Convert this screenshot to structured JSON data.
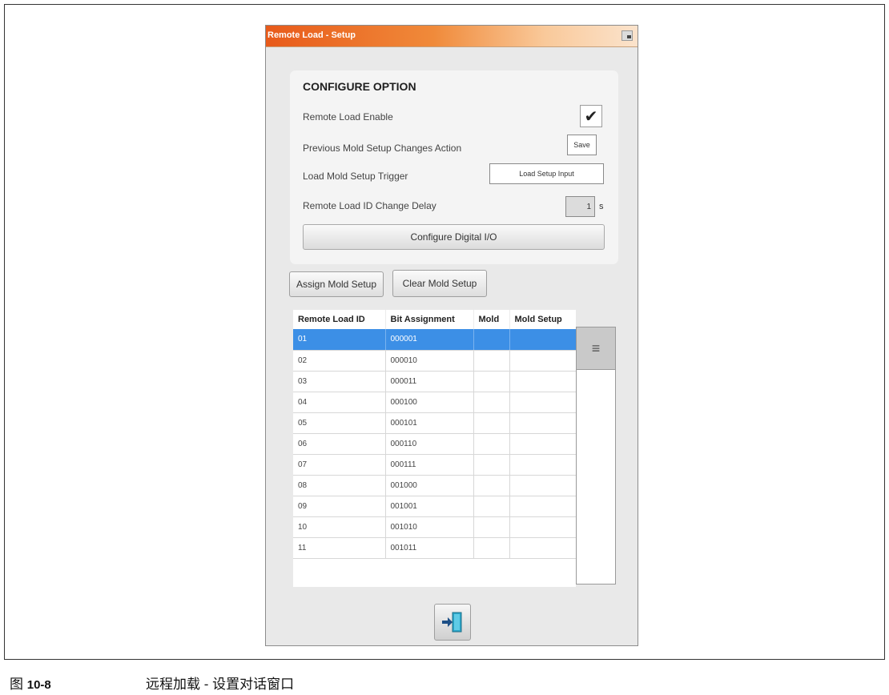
{
  "dialog": {
    "title": "Remote Load - Setup",
    "config": {
      "heading": "CONFIGURE OPTION",
      "remote_load_enable_label": "Remote Load Enable",
      "remote_load_enable_checked": true,
      "check_glyph": "✔",
      "prev_changes_label": "Previous Mold Setup Changes Action",
      "prev_changes_value": "Save",
      "trigger_label": "Load Mold Setup Trigger",
      "trigger_value": "Load Setup Input",
      "delay_label": "Remote Load ID Change Delay",
      "delay_value": "1",
      "delay_unit": "s",
      "configure_io_label": "Configure Digital I/O"
    },
    "assign_button": "Assign Mold Setup",
    "clear_button": "Clear Mold Setup",
    "table": {
      "headers": [
        "Remote Load ID",
        "Bit Assignment",
        "Mold",
        "Mold Setup"
      ],
      "rows": [
        {
          "id": "01",
          "bits": "000001",
          "mold": "",
          "setup": ""
        },
        {
          "id": "02",
          "bits": "000010",
          "mold": "",
          "setup": ""
        },
        {
          "id": "03",
          "bits": "000011",
          "mold": "",
          "setup": ""
        },
        {
          "id": "04",
          "bits": "000100",
          "mold": "",
          "setup": ""
        },
        {
          "id": "05",
          "bits": "000101",
          "mold": "",
          "setup": ""
        },
        {
          "id": "06",
          "bits": "000110",
          "mold": "",
          "setup": ""
        },
        {
          "id": "07",
          "bits": "000111",
          "mold": "",
          "setup": ""
        },
        {
          "id": "08",
          "bits": "001000",
          "mold": "",
          "setup": ""
        },
        {
          "id": "09",
          "bits": "001001",
          "mold": "",
          "setup": ""
        },
        {
          "id": "10",
          "bits": "001010",
          "mold": "",
          "setup": ""
        },
        {
          "id": "11",
          "bits": "001011",
          "mold": "",
          "setup": ""
        }
      ],
      "selected_index": 0,
      "selection_color": "#3c8fe6"
    },
    "scroll_thumb_glyph": "≡",
    "exit_icon": "exit-door-icon"
  },
  "caption": {
    "fig_prefix": "图",
    "fig_number": "10-8",
    "text": "远程加载 - 设置对话窗口"
  },
  "colors": {
    "title_gradient_start": "#e85a1a",
    "title_gradient_end": "#fbe3cc",
    "dialog_background": "#e9e9e9"
  }
}
